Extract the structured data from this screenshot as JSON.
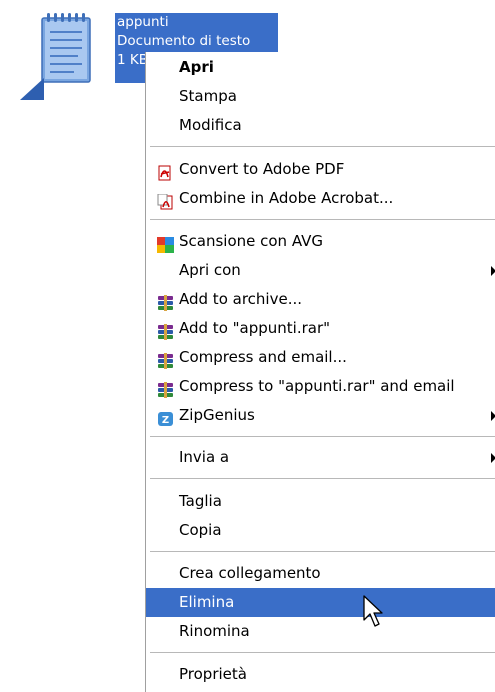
{
  "desktop_file": {
    "name": "appunti",
    "type": "Documento di testo",
    "size": "1 KB"
  },
  "menu": {
    "items": [
      {
        "id": "apri",
        "label": "Apri",
        "icon": "none"
      },
      {
        "id": "stampa",
        "label": "Stampa",
        "icon": "none"
      },
      {
        "id": "modifica",
        "label": "Modifica",
        "icon": "none"
      },
      {
        "id": "convert-pdf",
        "label": "Convert to Adobe PDF",
        "icon": "adobe-pdf-icon"
      },
      {
        "id": "combine-acrobat",
        "label": "Combine in Adobe Acrobat...",
        "icon": "adobe-acrobat-icon"
      },
      {
        "id": "scansione-avg",
        "label": "Scansione con AVG",
        "icon": "avg-icon"
      },
      {
        "id": "apri-con",
        "label": "Apri con",
        "icon": "none",
        "submenu": true
      },
      {
        "id": "add-archive",
        "label": "Add to archive...",
        "icon": "winrar-icon"
      },
      {
        "id": "add-rar",
        "label": "Add to \"appunti.rar\"",
        "icon": "winrar-icon"
      },
      {
        "id": "compress-email",
        "label": "Compress and email...",
        "icon": "winrar-icon"
      },
      {
        "id": "compress-rar-email",
        "label": "Compress to \"appunti.rar\" and email",
        "icon": "winrar-icon"
      },
      {
        "id": "zipgenius",
        "label": "ZipGenius",
        "icon": "zipgenius-icon",
        "submenu": true
      },
      {
        "id": "invia-a",
        "label": "Invia a",
        "icon": "none",
        "submenu": true
      },
      {
        "id": "taglia",
        "label": "Taglia",
        "icon": "none"
      },
      {
        "id": "copia",
        "label": "Copia",
        "icon": "none"
      },
      {
        "id": "crea-collegamento",
        "label": "Crea collegamento",
        "icon": "none"
      },
      {
        "id": "elimina",
        "label": "Elimina",
        "icon": "none",
        "highlighted": true
      },
      {
        "id": "rinomina",
        "label": "Rinomina",
        "icon": "none"
      },
      {
        "id": "proprieta",
        "label": "Proprietà",
        "icon": "none"
      }
    ]
  },
  "colors": {
    "selection": "#3a6ec8"
  }
}
